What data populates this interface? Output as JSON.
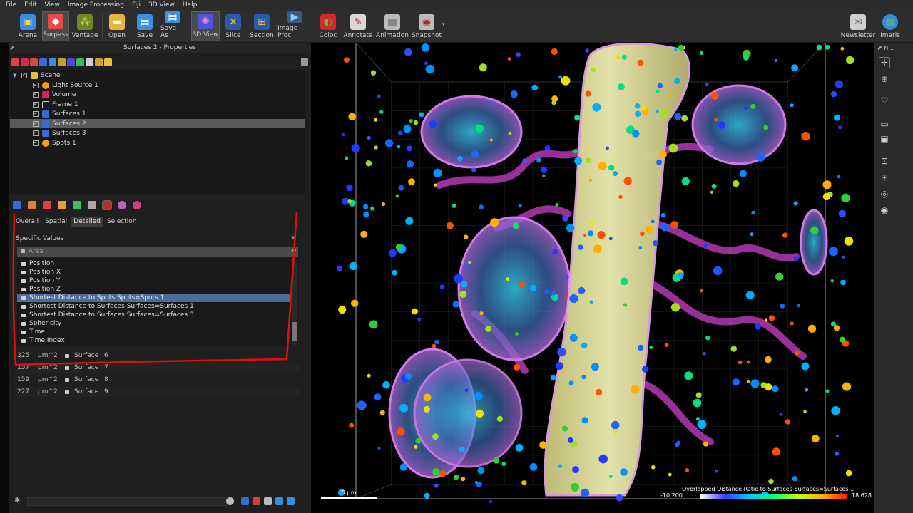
{
  "menu": [
    "File",
    "Edit",
    "View",
    "Image Processing",
    "Fiji",
    "3D View",
    "Help"
  ],
  "toolbar": {
    "buttons": [
      {
        "label": "Arena",
        "icon": "arena-icon"
      },
      {
        "label": "Surpass",
        "icon": "surpass-icon"
      },
      {
        "label": "Vantage",
        "icon": "vantage-icon"
      },
      {
        "label": "Open",
        "icon": "folder-icon"
      },
      {
        "label": "Save",
        "icon": "save-icon"
      },
      {
        "label": "Save As",
        "icon": "save-as-icon"
      },
      {
        "label": "3D View",
        "icon": "3d-view-icon"
      },
      {
        "label": "Slice",
        "icon": "slice-icon"
      },
      {
        "label": "Section",
        "icon": "section-icon"
      },
      {
        "label": "Image Proc",
        "icon": "image-proc-icon"
      },
      {
        "label": "Coloc",
        "icon": "coloc-icon"
      },
      {
        "label": "Annotate",
        "icon": "annotate-icon"
      },
      {
        "label": "Animation",
        "icon": "animation-icon"
      },
      {
        "label": "Snapshot",
        "icon": "camera-icon"
      },
      {
        "label": "Newsletter",
        "icon": "mail-icon"
      },
      {
        "label": "Imaris",
        "icon": "globe-icon"
      }
    ]
  },
  "panel": {
    "title": "Surfaces 2 - Properties",
    "tree": [
      {
        "label": "Scene",
        "icon": "folder-icon"
      },
      {
        "label": "Light Source 1",
        "icon": "light-icon"
      },
      {
        "label": "Volume",
        "icon": "volume-icon"
      },
      {
        "label": "Frame 1",
        "icon": "frame-icon"
      },
      {
        "label": "Surfaces 1",
        "icon": "surfaces-icon"
      },
      {
        "label": "Surfaces 2",
        "icon": "surfaces-icon"
      },
      {
        "label": "Surfaces 3",
        "icon": "surfaces-icon"
      },
      {
        "label": "Spots 1",
        "icon": "spots-icon"
      }
    ],
    "tabs": [
      "Overall",
      "Spatial",
      "Detailed",
      "Selection"
    ],
    "specific_values_label": "Specific Values",
    "dropdown_value": "Area",
    "list_items": [
      "Position",
      "Position X",
      "Position Y",
      "Position Z",
      "Shortest Distance to Spots Spots=Spots 1",
      "Shortest Distance to Surfaces Surfaces=Surfaces 1",
      "Shortest Distance to Surfaces Surfaces=Surfaces 3",
      "Sphericity",
      "Time",
      "Time Index"
    ],
    "stats_rows": [
      {
        "value": "325",
        "unit": "µm^2",
        "name": "Surface",
        "id": "6"
      },
      {
        "value": "157",
        "unit": "µm^2",
        "name": "Surface",
        "id": "7"
      },
      {
        "value": "159",
        "unit": "µm^2",
        "name": "Surface",
        "id": "8"
      },
      {
        "value": "227",
        "unit": "µm^2",
        "name": "Surface",
        "id": "9"
      }
    ]
  },
  "viewer": {
    "scale_label": "5 µm",
    "colorbar_title": "Overlapped Distance Ratio to Surfaces Surfaces=Surfaces 1",
    "colorbar_min": "-10.200",
    "colorbar_max": "18.628"
  },
  "right_sidebar": {
    "header": "N..."
  }
}
